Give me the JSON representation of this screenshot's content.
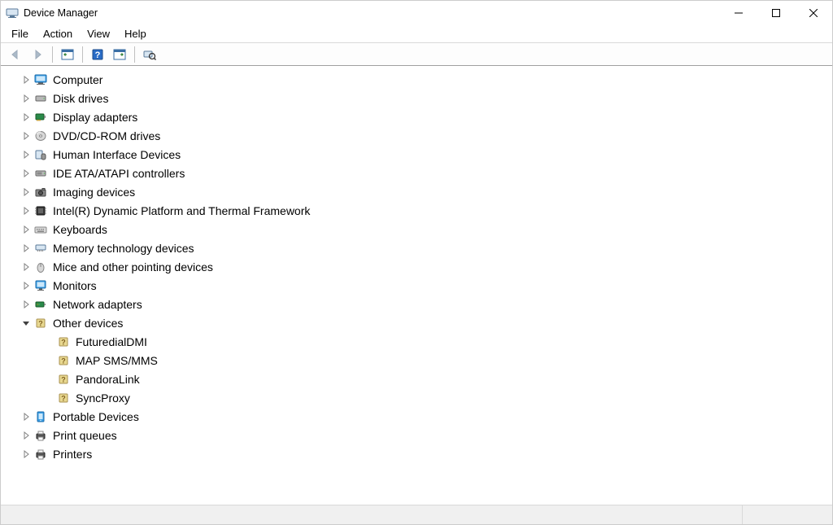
{
  "window": {
    "title": "Device Manager"
  },
  "menu": {
    "file": "File",
    "action": "Action",
    "view": "View",
    "help": "Help"
  },
  "toolbar": {
    "back": "back",
    "forward": "forward",
    "show_hide": "show-hide-console-tree",
    "help": "help",
    "action": "action",
    "scan": "scan-for-hardware-changes"
  },
  "tree": [
    {
      "id": "computer",
      "label": "Computer",
      "icon": "computer",
      "expanded": false,
      "children": []
    },
    {
      "id": "disk-drives",
      "label": "Disk drives",
      "icon": "disk",
      "expanded": false,
      "children": []
    },
    {
      "id": "display-adapters",
      "label": "Display adapters",
      "icon": "display-adapter",
      "expanded": false,
      "children": []
    },
    {
      "id": "dvd-cd-rom",
      "label": "DVD/CD-ROM drives",
      "icon": "optical",
      "expanded": false,
      "children": []
    },
    {
      "id": "hid",
      "label": "Human Interface Devices",
      "icon": "hid",
      "expanded": false,
      "children": []
    },
    {
      "id": "ide",
      "label": "IDE ATA/ATAPI controllers",
      "icon": "ide",
      "expanded": false,
      "children": []
    },
    {
      "id": "imaging",
      "label": "Imaging devices",
      "icon": "camera",
      "expanded": false,
      "children": []
    },
    {
      "id": "intel-dptf",
      "label": "Intel(R) Dynamic Platform and Thermal Framework",
      "icon": "chip",
      "expanded": false,
      "children": []
    },
    {
      "id": "keyboards",
      "label": "Keyboards",
      "icon": "keyboard",
      "expanded": false,
      "children": []
    },
    {
      "id": "memory-tech",
      "label": "Memory technology devices",
      "icon": "memory",
      "expanded": false,
      "children": []
    },
    {
      "id": "mice",
      "label": "Mice and other pointing devices",
      "icon": "mouse",
      "expanded": false,
      "children": []
    },
    {
      "id": "monitors",
      "label": "Monitors",
      "icon": "monitor",
      "expanded": false,
      "children": []
    },
    {
      "id": "network",
      "label": "Network adapters",
      "icon": "network",
      "expanded": false,
      "children": []
    },
    {
      "id": "other",
      "label": "Other devices",
      "icon": "other",
      "expanded": true,
      "children": [
        {
          "id": "futuredialdmi",
          "label": "FuturedialDMI",
          "icon": "unknown"
        },
        {
          "id": "map-sms-mms",
          "label": "MAP SMS/MMS",
          "icon": "unknown"
        },
        {
          "id": "pandoralink",
          "label": "PandoraLink",
          "icon": "unknown"
        },
        {
          "id": "syncproxy",
          "label": "SyncProxy",
          "icon": "unknown"
        }
      ]
    },
    {
      "id": "portable",
      "label": "Portable Devices",
      "icon": "portable",
      "expanded": false,
      "children": []
    },
    {
      "id": "print-queues",
      "label": "Print queues",
      "icon": "printer",
      "expanded": false,
      "children": []
    },
    {
      "id": "printers",
      "label": "Printers",
      "icon": "printer",
      "expanded": false,
      "children": []
    }
  ]
}
